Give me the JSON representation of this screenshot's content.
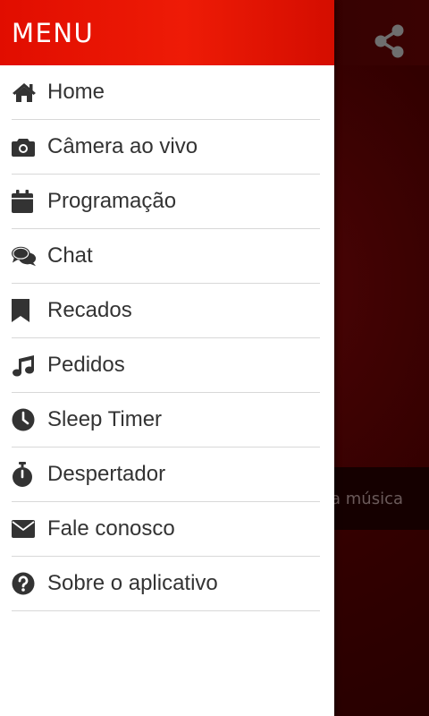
{
  "drawer": {
    "title": "MENU",
    "items": [
      {
        "label": "Home",
        "icon": "home-icon"
      },
      {
        "label": "Câmera ao vivo",
        "icon": "camera-icon"
      },
      {
        "label": "Programação",
        "icon": "calendar-icon"
      },
      {
        "label": "Chat",
        "icon": "chat-icon"
      },
      {
        "label": "Recados",
        "icon": "bookmark-icon"
      },
      {
        "label": "Pedidos",
        "icon": "music-note-icon"
      },
      {
        "label": "Sleep Timer",
        "icon": "clock-icon"
      },
      {
        "label": "Despertador",
        "icon": "stopwatch-icon"
      },
      {
        "label": "Fale conosco",
        "icon": "envelope-icon"
      },
      {
        "label": "Sobre o aplicativo",
        "icon": "question-circle-icon"
      }
    ]
  },
  "background": {
    "share_icon": "share-icon",
    "song_text": "a música"
  },
  "colors": {
    "header_red": "#e60f02",
    "text": "#333333",
    "background_dark_red": "#2a0000"
  }
}
